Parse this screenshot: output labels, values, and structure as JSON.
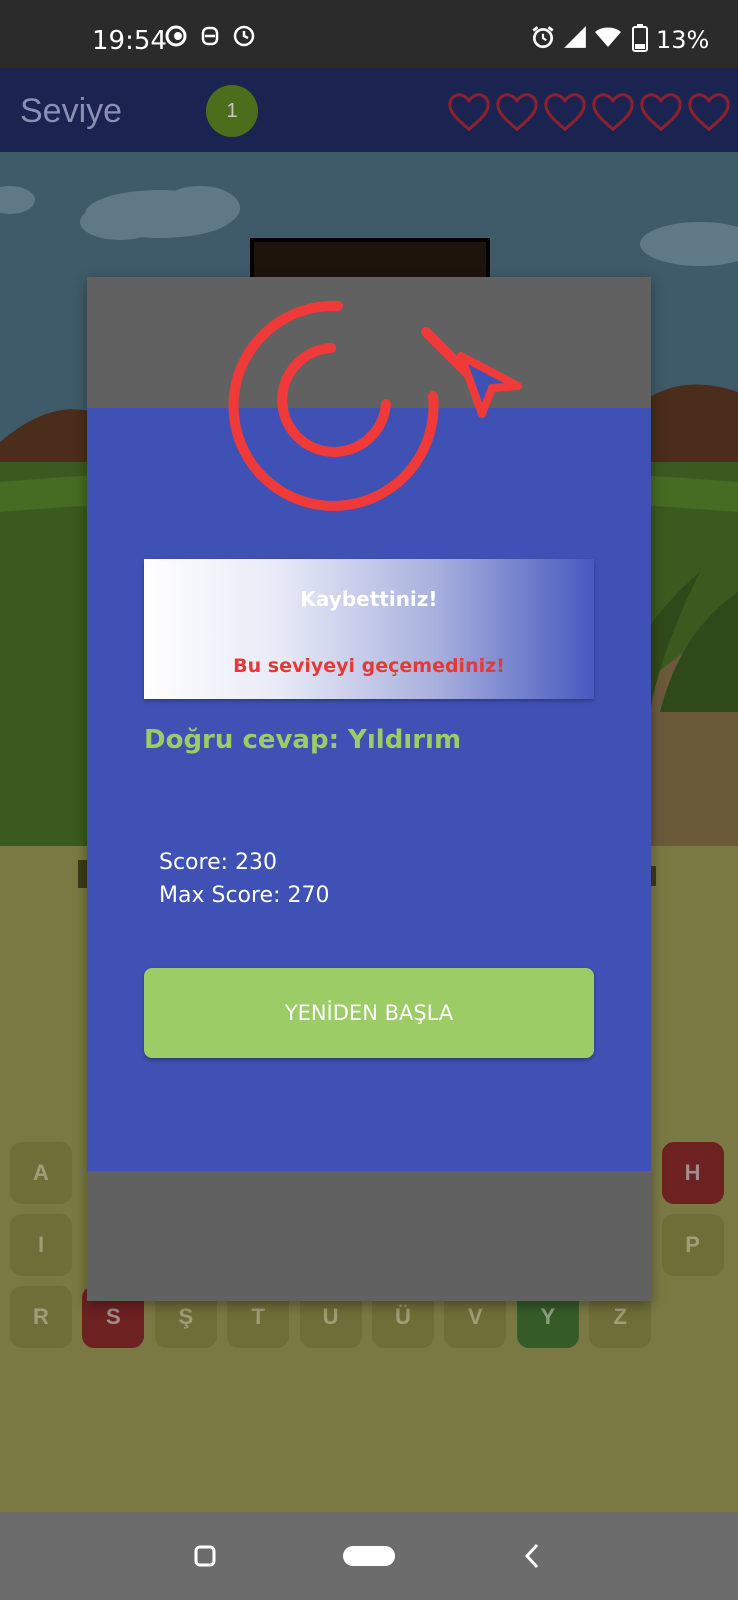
{
  "status_bar": {
    "time": "19:54",
    "battery": "13%"
  },
  "app_bar": {
    "title": "Seviye",
    "level": "1",
    "lives": 6
  },
  "keyboard": {
    "rows": [
      [
        {
          "l": "A",
          "s": "normal"
        },
        {
          "l": "H",
          "s": "red"
        }
      ],
      [
        {
          "l": "I",
          "s": "normal"
        },
        {
          "l": "P",
          "s": "normal"
        }
      ],
      [
        {
          "l": "R",
          "s": "normal"
        },
        {
          "l": "S",
          "s": "red"
        },
        {
          "l": "Ş",
          "s": "normal"
        },
        {
          "l": "T",
          "s": "normal"
        },
        {
          "l": "U",
          "s": "normal"
        },
        {
          "l": "Ü",
          "s": "normal"
        },
        {
          "l": "V",
          "s": "normal"
        },
        {
          "l": "Y",
          "s": "green"
        },
        {
          "l": "Z",
          "s": "normal"
        }
      ]
    ]
  },
  "dialog": {
    "title": "Kaybettiniz!",
    "subtitle": "Bu seviyeyi geçemediniz!",
    "correct_answer": "Doğru cevap: Yıldırım",
    "score": "Score: 230",
    "max_score": "Max Score: 270",
    "restart_button": "YENİDEN BAŞLA"
  },
  "colors": {
    "accent": "#3f51b5",
    "success": "#9ccc65",
    "error": "#e53935",
    "target": "#f03a3a"
  }
}
